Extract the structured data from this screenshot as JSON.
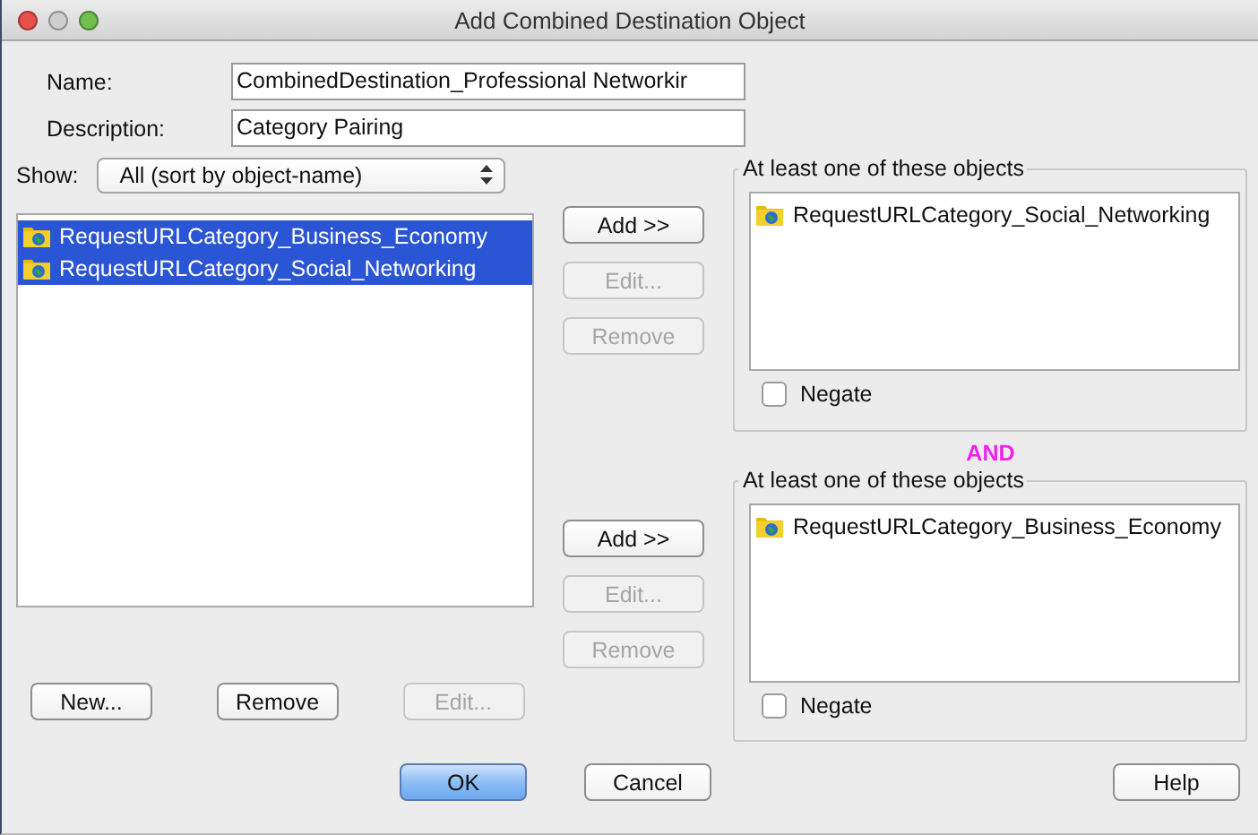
{
  "window": {
    "title": "Add Combined Destination Object"
  },
  "fields": [
    {
      "label": "Name:",
      "value": "CombinedDestination_Professional Networkir"
    },
    {
      "label": "Description:",
      "value": "Category Pairing"
    }
  ],
  "show": {
    "label": "Show:",
    "value": "All (sort by object-name)"
  },
  "objects": [
    {
      "label": "RequestURLCategory_Business_Economy",
      "selected": true
    },
    {
      "label": "RequestURLCategory_Social_Networking",
      "selected": true
    }
  ],
  "object_buttons": [
    {
      "label": "New...",
      "disabled": false
    },
    {
      "label": "Remove",
      "disabled": false
    },
    {
      "label": "Edit...",
      "disabled": true
    }
  ],
  "groups": [
    {
      "title": "At least one of these objects",
      "buttons": [
        {
          "label": "Add >>",
          "disabled": false
        },
        {
          "label": "Edit...",
          "disabled": true
        },
        {
          "label": "Remove",
          "disabled": true
        }
      ],
      "items": [
        {
          "label": "RequestURLCategory_Social_Networking"
        }
      ],
      "negate": {
        "label": "Negate",
        "checked": false
      }
    },
    {
      "title": "At least one of these objects",
      "buttons": [
        {
          "label": "Add >>",
          "disabled": false
        },
        {
          "label": "Edit...",
          "disabled": true
        },
        {
          "label": "Remove",
          "disabled": true
        }
      ],
      "items": [
        {
          "label": "RequestURLCategory_Business_Economy"
        }
      ],
      "negate": {
        "label": "Negate",
        "checked": false
      }
    }
  ],
  "connector": "AND",
  "dialog_buttons": [
    {
      "label": "OK",
      "default": true
    },
    {
      "label": "Cancel",
      "default": false
    },
    {
      "label": "Help",
      "default": false
    }
  ]
}
